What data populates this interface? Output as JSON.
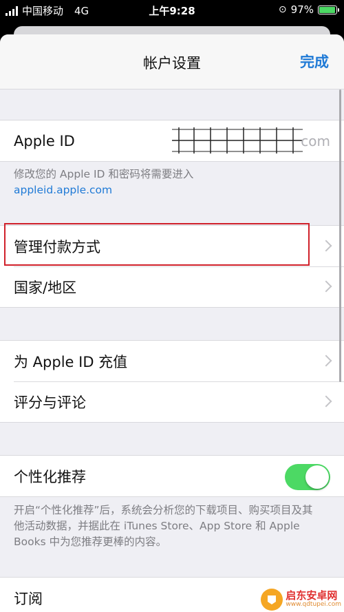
{
  "status_bar": {
    "carrier": "中国移动",
    "network": "4G",
    "time": "上午9:28",
    "battery": "97%",
    "battery_level": 0.97
  },
  "nav": {
    "title": "帐户设置",
    "done_label": "完成"
  },
  "apple_id": {
    "label": "Apple ID",
    "value_suffix": "com"
  },
  "apple_id_note": {
    "text": "修改您的 Apple ID 和密码将需要进入",
    "link": "appleid.apple.com"
  },
  "payment_group": {
    "items": [
      {
        "label": "管理付款方式"
      },
      {
        "label": "国家/地区"
      }
    ]
  },
  "topup_group": {
    "items": [
      {
        "label": "为 Apple ID 充值"
      },
      {
        "label": "评分与评论"
      }
    ]
  },
  "personalization": {
    "label": "个性化推荐",
    "enabled": true
  },
  "personalization_note": {
    "text": "开启“个性化推荐”后，系统会分析您的下载项目、购买项目及其他活动数据，并据此在 iTunes Store、App Store 和 Apple Books 中为您推荐更棒的内容。"
  },
  "subscriptions": {
    "label": "订阅"
  },
  "watermark": {
    "title": "启东安卓网",
    "url": "www.qdtupei.com"
  },
  "colors": {
    "accent": "#1f7ad6",
    "toggle_on": "#4cd964",
    "highlight": "#d0202a"
  }
}
